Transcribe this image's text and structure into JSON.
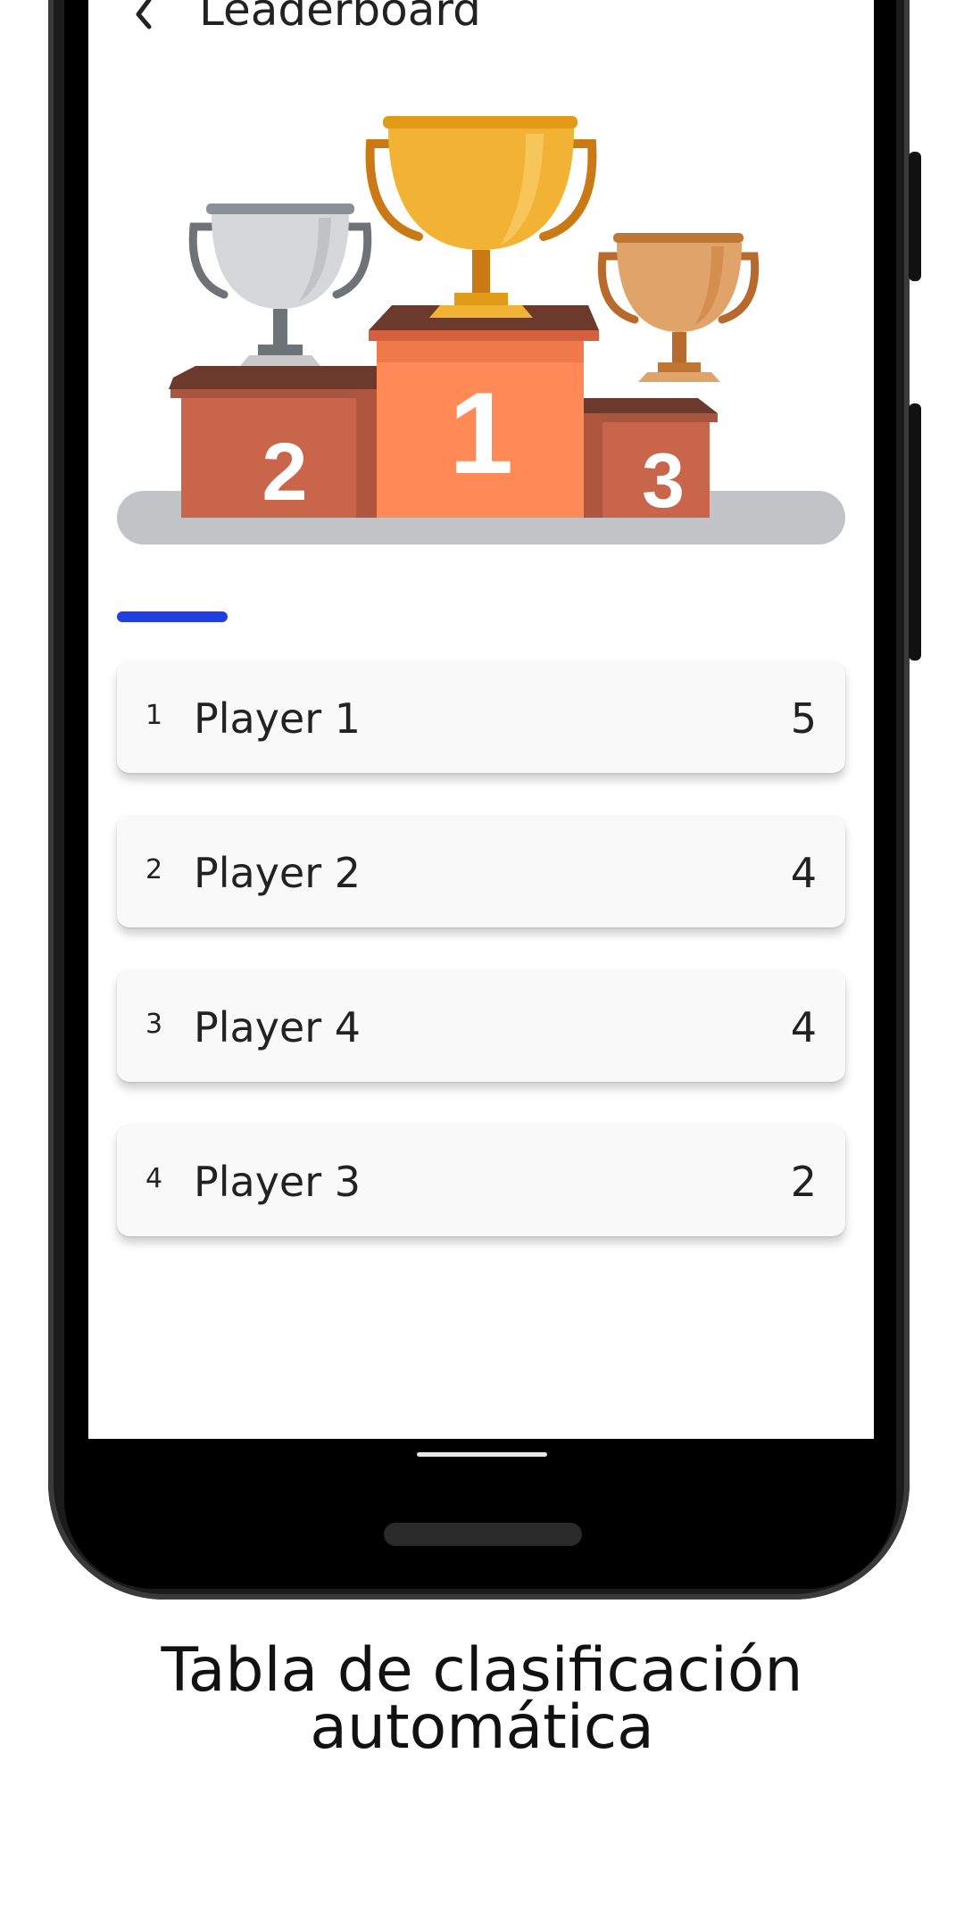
{
  "header": {
    "title": "Leaderboard",
    "back_icon": "chevron-left-icon"
  },
  "podium": {
    "places": [
      {
        "label": "2",
        "trophy": "silver"
      },
      {
        "label": "1",
        "trophy": "gold"
      },
      {
        "label": "3",
        "trophy": "bronze"
      }
    ],
    "colors": {
      "first": "#ff8a57",
      "side": "#c9654a",
      "gold": "#f2b233",
      "silver": "#d6d7da",
      "bronze": "#e0a46a"
    }
  },
  "tab_indicator_color": "#1f3fe0",
  "leaderboard": [
    {
      "rank": "1",
      "name": "Player 1",
      "score": "5"
    },
    {
      "rank": "2",
      "name": "Player 2",
      "score": "4"
    },
    {
      "rank": "3",
      "name": "Player 4",
      "score": "4"
    },
    {
      "rank": "4",
      "name": "Player 3",
      "score": "2"
    }
  ],
  "caption": {
    "line1": "Tabla de clasificación",
    "line2": "automática"
  }
}
